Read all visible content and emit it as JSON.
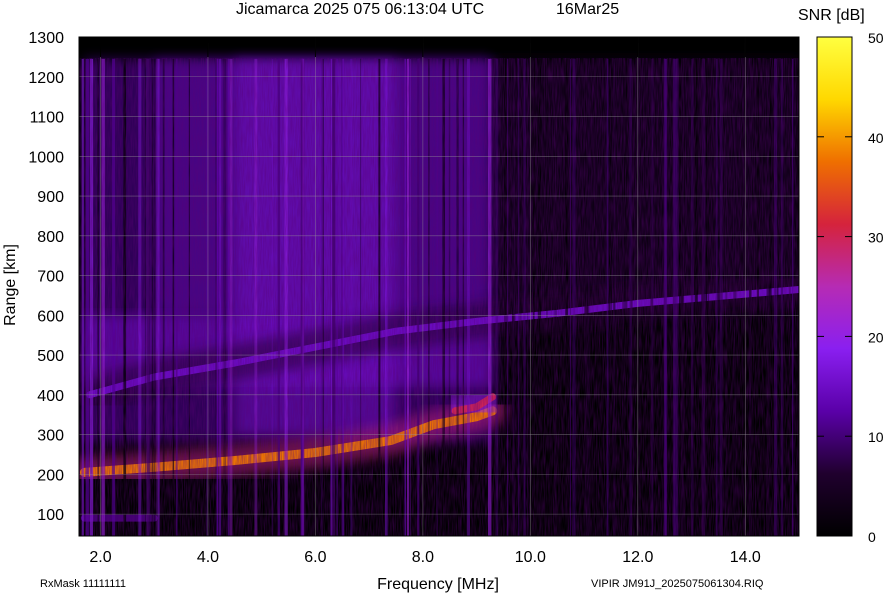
{
  "header": {
    "title": "Jicamarca 2025 075 06:13:04 UTC",
    "date": "16Mar25"
  },
  "footer": {
    "rxmask": "RxMask 11111111",
    "file": "VIPIR  JM91J_2025075061304.RIQ"
  },
  "chart_data": {
    "type": "heatmap",
    "title": "Jicamarca 2025 075 06:13:04 UTC",
    "xlabel": "Frequency [MHz]",
    "ylabel": "Range [km]",
    "xlim": [
      1.6,
      15.0
    ],
    "ylim": [
      45,
      1300
    ],
    "xticks": [
      2.0,
      4.0,
      6.0,
      8.0,
      10.0,
      12.0,
      14.0
    ],
    "xtick_labels": [
      "2.0",
      "4.0",
      "6.0",
      "8.0",
      "10.0",
      "12.0",
      "14.0"
    ],
    "yticks": [
      100,
      200,
      300,
      400,
      500,
      600,
      700,
      800,
      900,
      1000,
      1100,
      1200,
      1300
    ],
    "ytick_labels": [
      "100",
      "200",
      "300",
      "400",
      "500",
      "600",
      "700",
      "800",
      "900",
      "1000",
      "1100",
      "1200",
      "1300"
    ],
    "grid": true,
    "data_range_max_km": 1245,
    "colorbar": {
      "label": "SNR [dB]",
      "min": 0,
      "max": 50,
      "ticks": [
        0,
        10,
        20,
        30,
        40,
        50
      ],
      "tick_labels": [
        "0",
        "10",
        "20",
        "30",
        "40",
        "50"
      ],
      "colors": [
        "#000000",
        "#20002e",
        "#5a00a8",
        "#8a1ff0",
        "#b62bb4",
        "#d5233c",
        "#ef6f00",
        "#ffd800",
        "#ffff40"
      ]
    },
    "features": [
      {
        "name": "F2 trace",
        "points": [
          [
            1.7,
            205
          ],
          [
            3.0,
            218
          ],
          [
            4.5,
            235
          ],
          [
            6.0,
            255
          ],
          [
            7.4,
            285
          ],
          [
            8.2,
            325
          ],
          [
            9.0,
            345
          ],
          [
            9.3,
            360
          ]
        ],
        "snr_db": 38
      },
      {
        "name": "F2 upper edge",
        "points": [
          [
            8.6,
            360
          ],
          [
            9.0,
            370
          ],
          [
            9.3,
            395
          ]
        ],
        "snr_db": 30
      },
      {
        "name": "multi-hop trace",
        "points": [
          [
            1.8,
            400
          ],
          [
            3.0,
            445
          ],
          [
            4.5,
            480
          ],
          [
            6.0,
            520
          ],
          [
            7.5,
            560
          ],
          [
            9.0,
            585
          ],
          [
            10.5,
            605
          ],
          [
            12.0,
            630
          ],
          [
            15.0,
            665
          ]
        ],
        "snr_db": 15
      },
      {
        "name": "low-range echoes",
        "points": [
          [
            1.7,
            90
          ],
          [
            3.0,
            90
          ]
        ],
        "snr_db": 10
      }
    ]
  }
}
